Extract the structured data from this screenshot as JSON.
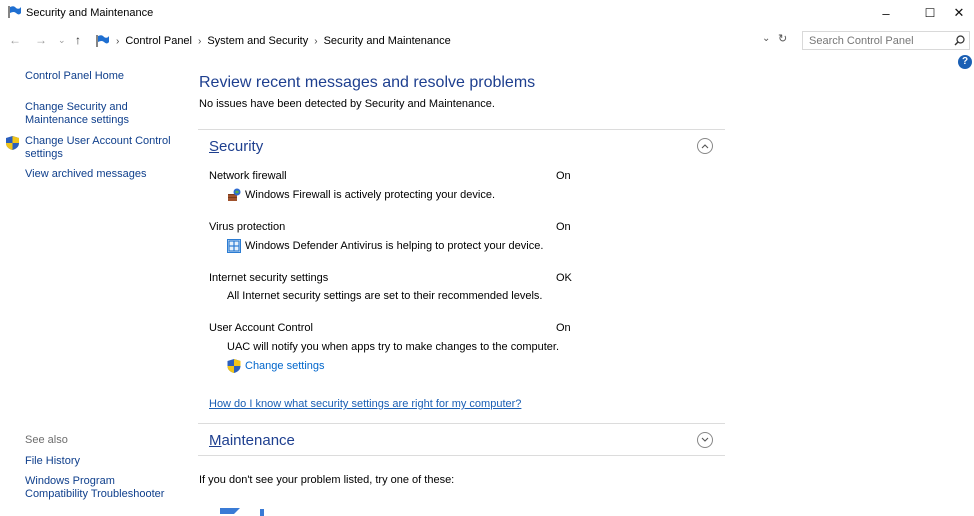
{
  "window": {
    "title": "Security and Maintenance",
    "minimize": "–",
    "maximize": "☐",
    "close": "✕"
  },
  "address_bar": {
    "breadcrumbs": [
      "Control Panel",
      "System and Security",
      "Security and Maintenance"
    ],
    "search_placeholder": "Search Control Panel"
  },
  "sidebar": {
    "home": "Control Panel Home",
    "links": [
      "Change Security and Maintenance settings",
      "Change User Account Control settings",
      "View archived messages"
    ],
    "see_also_heading": "See also",
    "see_also": [
      "File History",
      "Windows Program Compatibility Troubleshooter"
    ]
  },
  "main": {
    "title": "Review recent messages and resolve problems",
    "subtitle": "No issues have been detected by Security and Maintenance.",
    "security": {
      "heading_accel": "S",
      "heading_rest": "ecurity",
      "items": [
        {
          "label": "Network firewall",
          "status": "On",
          "desc": "Windows Firewall is actively protecting your device."
        },
        {
          "label": "Virus protection",
          "status": "On",
          "desc": "Windows Defender Antivirus is helping to protect your device."
        },
        {
          "label": "Internet security settings",
          "status": "OK",
          "desc": "All Internet security settings are set to their recommended levels."
        },
        {
          "label": "User Account Control",
          "status": "On",
          "desc": "UAC will notify you when apps try to make changes to the computer."
        }
      ],
      "change_settings": "Change settings",
      "help_link": "How do I know what security settings are right for my computer?"
    },
    "maintenance": {
      "heading_accel": "M",
      "heading_rest": "aintenance"
    },
    "bottom_text": "If you don't see your problem listed, try one of these:"
  },
  "colors": {
    "link": "#0066cc",
    "heading": "#1e3f8f"
  }
}
